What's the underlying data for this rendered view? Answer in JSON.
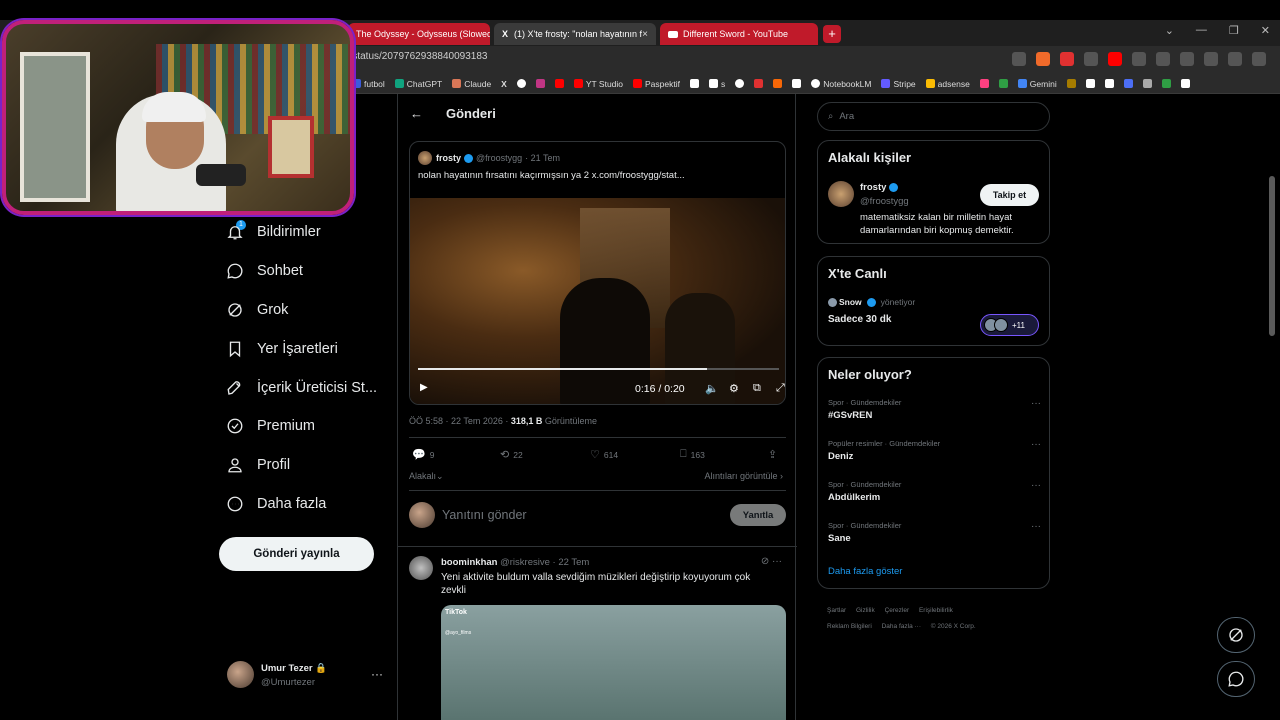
{
  "browser": {
    "tabs": [
      {
        "title": "The Odyssey - Odysseus (Slowed + R",
        "close": "×"
      },
      {
        "title": "(1) X'te frosty: \"nolan hayatının f",
        "close": "×"
      },
      {
        "title": "Different Sword - YouTube",
        "close": "×"
      }
    ],
    "new_tab": "+",
    "url": "g/status/2079762938840093183",
    "bookmarks": [
      "futbol",
      "ChatGPT",
      "Claude",
      "X",
      "",
      "",
      "YT Studio",
      "Paspektif",
      "",
      "s",
      "",
      "",
      "",
      "",
      "NotebookLM",
      "Stripe",
      "adsense",
      "",
      "",
      "Gemini"
    ],
    "bookmark_colors": [
      "#3b5bdb",
      "#10a37f",
      "#d97757",
      "#fff",
      "#fff",
      "#c13584",
      "#ff0000",
      "#ff0000",
      "#fff",
      "#fff",
      "#fff",
      "#e03131",
      "#f76707",
      "#fff",
      "#fff",
      "#635bff",
      "#fbbc04",
      "#ff4081",
      "#2f9e44",
      "#4285f4"
    ]
  },
  "nav": {
    "items": [
      {
        "label": "Bildirimler",
        "icon": "bell-icon"
      },
      {
        "label": "Sohbet",
        "icon": "chat-icon"
      },
      {
        "label": "Grok",
        "icon": "grok-icon"
      },
      {
        "label": "Yer İşaretleri",
        "icon": "bookmark-icon"
      },
      {
        "label": "İçerik Üreticisi St...",
        "icon": "rocket-icon"
      },
      {
        "label": "Premium",
        "icon": "verified-icon"
      },
      {
        "label": "Profil",
        "icon": "person-icon"
      },
      {
        "label": "Daha fazla",
        "icon": "more-circle-icon"
      }
    ],
    "notification_count": "1",
    "post_button": "Gönderi yayınla",
    "account": {
      "name": "Umur Tezer",
      "handle": "@Umurtezer",
      "more": "···"
    }
  },
  "main": {
    "header_title": "Gönderi",
    "quoted": {
      "name": "frosty",
      "handle": "@froostygg",
      "time": "· 21 Tem",
      "text": "nolan hayatının fırsatını kaçırmışsın ya 2  x.com/froostygg/stat...",
      "video_time": "0:16 / 0:20",
      "progress": 0.8
    },
    "meta": {
      "time": "ÖÖ 5:58 · 22 Tem 2026 · ",
      "views": "318,1 B",
      "views_label": " Görüntüleme"
    },
    "actions": {
      "replies": "9",
      "reposts": "22",
      "likes": "614",
      "bookmarks": "163"
    },
    "related": "Alakalı",
    "quotes_link": "Alıntıları görüntüle ›",
    "reply_placeholder": "Yanıtını gönder",
    "reply_button": "Yanıtla",
    "reply_post": {
      "name": "boominkhan",
      "handle": "@riskresive",
      "time": "· 22 Tem",
      "text": "Yeni aktivite buldum valla sevdiğim müzikleri değiştirip koyuyorum çok zevkli",
      "media_brand": "TikTok",
      "media_user": "@ayo_films"
    }
  },
  "right": {
    "search_placeholder": "Ara",
    "related_people": {
      "title": "Alakalı kişiler",
      "name": "frosty",
      "handle": "@froostygg",
      "bio": "matematiksiz kalan bir milletin hayat damarlarından biri kopmuş demektir.",
      "follow": "Takip et"
    },
    "live": {
      "title": "X'te Canlı",
      "host": "Snow",
      "host_role": "yönetiyor",
      "space_title": "Sadece 30 dk",
      "listeners": "+11"
    },
    "trends": {
      "title": "Neler oluyor?",
      "items": [
        {
          "category": "Spor · Gündemdekiler",
          "name": "#GSvREN"
        },
        {
          "category": "Popüler resimler · Gündemdekiler",
          "name": "Deniz"
        },
        {
          "category": "Spor · Gündemdekiler",
          "name": "Abdülkerim"
        },
        {
          "category": "Spor · Gündemdekiler",
          "name": "Sane"
        }
      ],
      "show_more": "Daha fazla göster"
    },
    "footer": [
      "Şartlar",
      "Gizlilik",
      "Çerezler",
      "Erişilebilirlik",
      "Reklam Bilgileri",
      "Daha fazla ···",
      "© 2026 X Corp."
    ]
  },
  "colors": {
    "accent": "#1d9bf0",
    "webcam_border": "#c0207a",
    "tab_red": "#c01a2a"
  }
}
